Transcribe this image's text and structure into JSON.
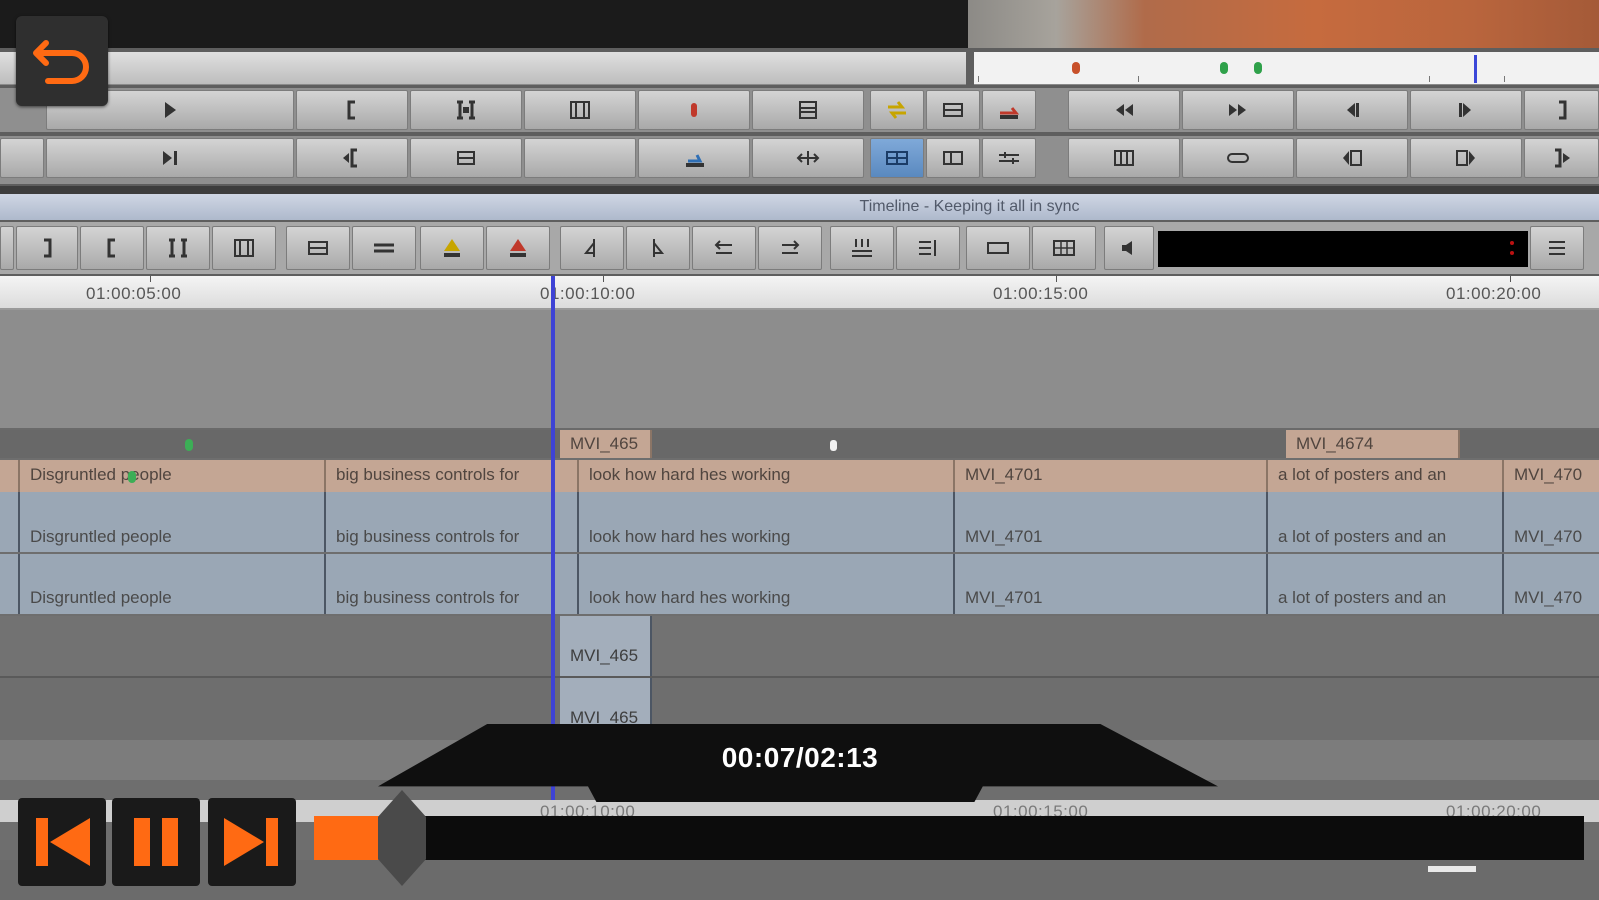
{
  "window": {
    "timeline_title": "Timeline - Keeping it all in sync"
  },
  "player": {
    "time_display": "00:07/02:13",
    "progress": 0.055,
    "accent_color": "#ff6a13"
  },
  "ruler": {
    "labels": [
      "01:00:05:00",
      "01:00:10:00",
      "01:00:15:00",
      "01:00:20:00"
    ]
  },
  "tracks": {
    "v2": [
      {
        "label": "MVI_465",
        "color": "tan"
      },
      {
        "label": "MVI_4674",
        "color": "tan"
      }
    ],
    "v1": [
      "Disgruntled people",
      "big business controls for",
      "look how hard hes working",
      "MVI_4701",
      "a lot of posters and an",
      "MVI_470"
    ],
    "a1": [
      "Disgruntled people",
      "big business controls for",
      "look how hard hes working",
      "MVI_4701",
      "a lot of posters and an",
      "MVI_470"
    ],
    "a2": [
      "Disgruntled people",
      "big business controls for",
      "look how hard hes working",
      "MVI_4701",
      "a lot of posters and an",
      "MVI_470"
    ],
    "a3": "MVI_465",
    "a4": "MVI_465"
  },
  "icons": {
    "back": "undo-arrow-icon",
    "player_prev": "skip-back-icon",
    "player_pause": "pause-icon",
    "player_next": "skip-forward-icon"
  }
}
